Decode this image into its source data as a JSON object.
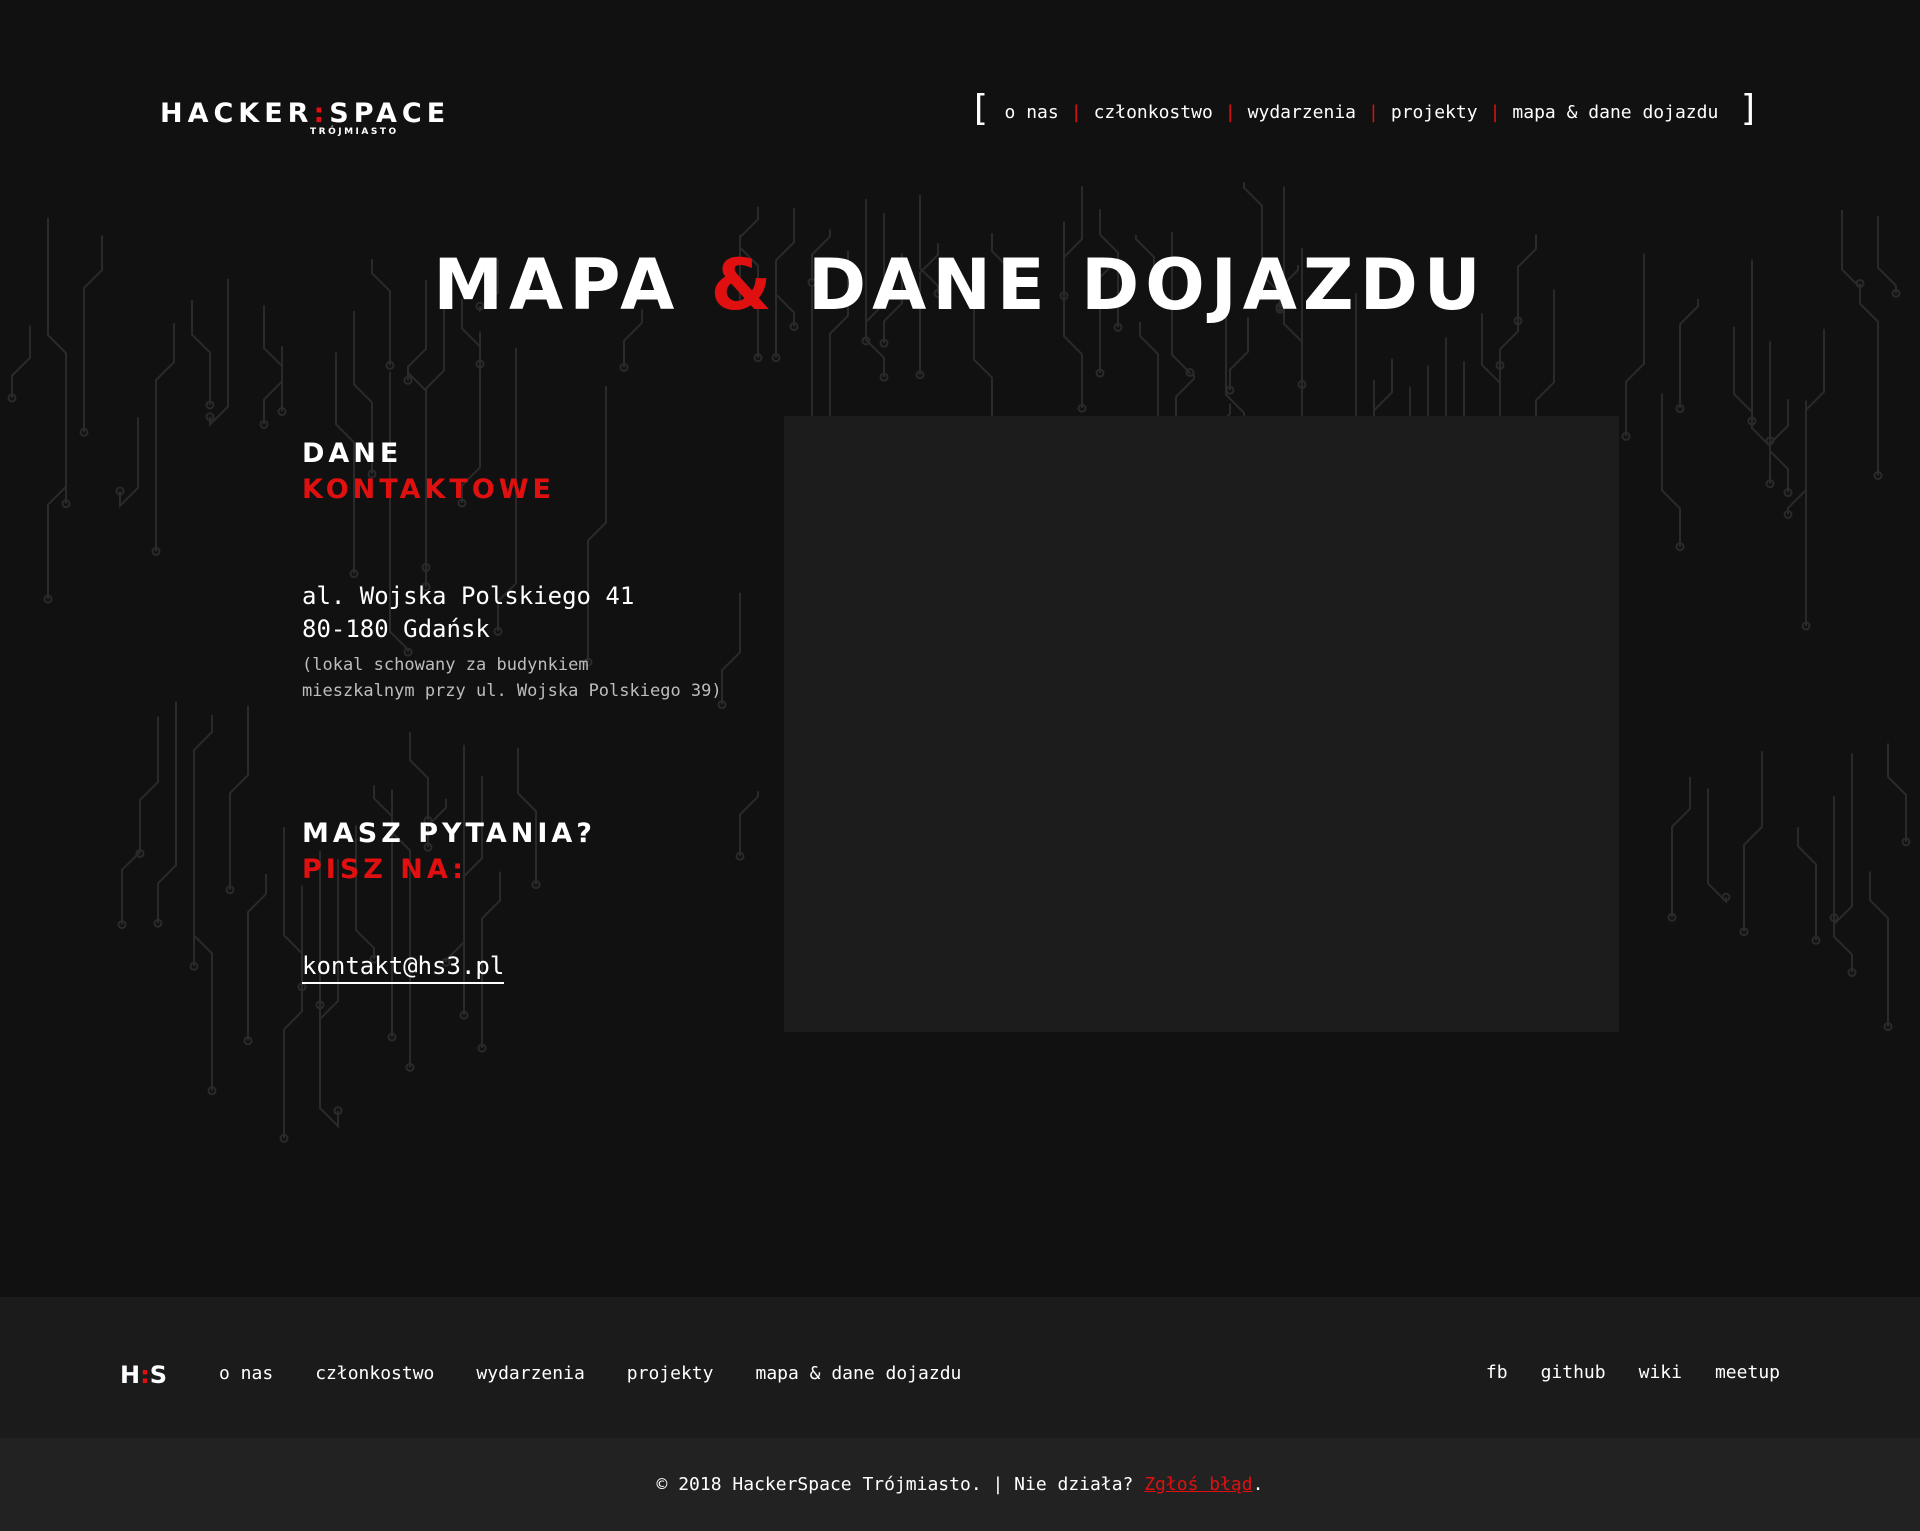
{
  "header": {
    "logo_main_left": "HACKER",
    "logo_colon": ":",
    "logo_main_right": "SPACE",
    "logo_sub": "TRÓJMIASTO",
    "nav": [
      {
        "label": "o nas"
      },
      {
        "label": "członkostwo"
      },
      {
        "label": "wydarzenia"
      },
      {
        "label": "projekty"
      },
      {
        "label": "mapa & dane dojazdu"
      }
    ],
    "separator": "|",
    "bracket_left": "[",
    "bracket_right": "]"
  },
  "title": {
    "part1": "MAPA",
    "amp": "&",
    "part2": "DANE DOJAZDU"
  },
  "contact": {
    "heading_white": "DANE",
    "heading_red": "KONTAKTOWE",
    "address_line1": "al. Wojska Polskiego 41",
    "address_line2": "80-180 Gdańsk",
    "note_line1": "(lokal schowany za budynkiem",
    "note_line2": "mieszkalnym przy ul. Wojska Polskiego 39)"
  },
  "questions": {
    "heading_white": "MASZ PYTANIA?",
    "heading_red": "PISZ NA:",
    "email": "kontakt@hs3.pl"
  },
  "footer": {
    "logo_left": "H",
    "logo_colon": ":",
    "logo_right": "S",
    "links": [
      {
        "label": "o nas"
      },
      {
        "label": "członkostwo"
      },
      {
        "label": "wydarzenia"
      },
      {
        "label": "projekty"
      },
      {
        "label": "mapa & dane dojazdu"
      }
    ],
    "social": [
      {
        "label": "fb"
      },
      {
        "label": "github"
      },
      {
        "label": "wiki"
      },
      {
        "label": "meetup"
      }
    ],
    "copyright": "© 2018 HackerSpace Trójmiasto. | Nie działa? ",
    "report_link": "Zgłoś błąd",
    "period": "."
  },
  "colors": {
    "background": "#111111",
    "accent": "#e01010",
    "map_placeholder": "#1c1c1c",
    "footer_nav_bg": "#1b1b1b",
    "footer_bottom_bg": "#222222"
  }
}
